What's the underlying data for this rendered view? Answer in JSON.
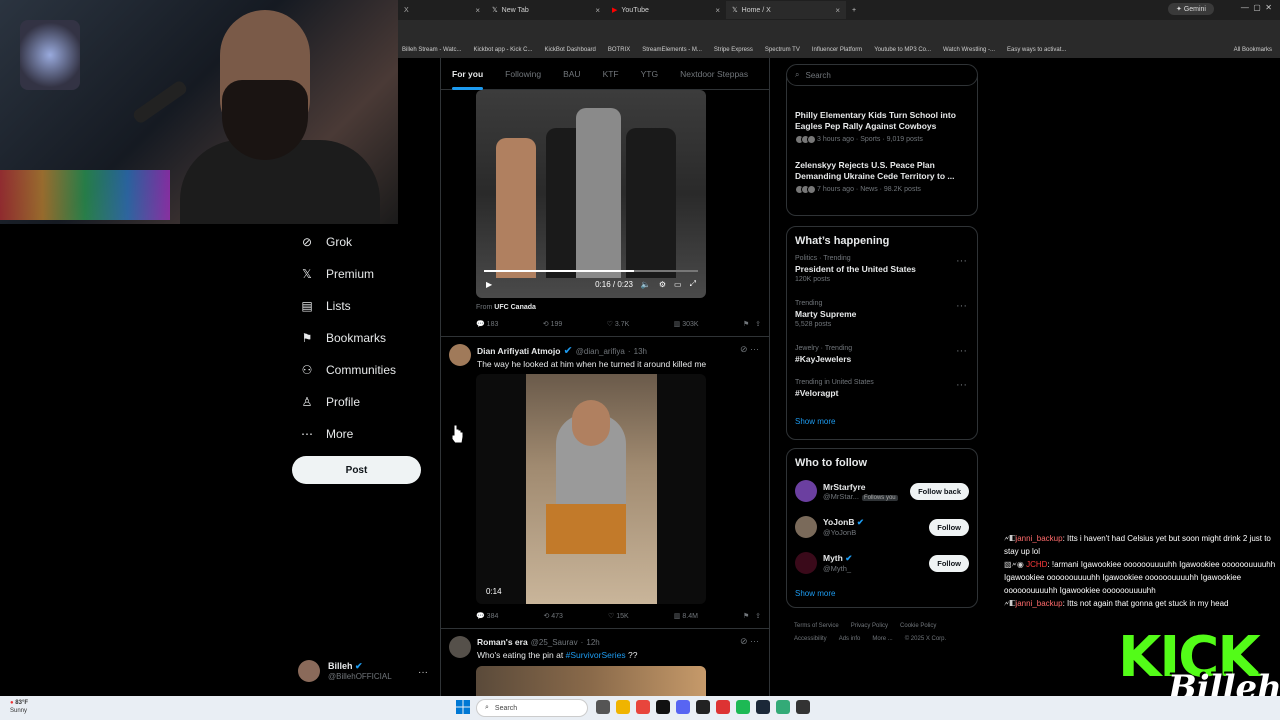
{
  "browser": {
    "tabs": [
      {
        "label": "New Tab",
        "icon": "x-logo-icon"
      },
      {
        "label": "YouTube",
        "icon": "youtube-icon"
      },
      {
        "label": "Home / X",
        "icon": "x-logo-icon"
      }
    ],
    "gemini_label": "Gemini",
    "bookmarks": [
      "Billeh Stream - Watc...",
      "Kickbot app - Kick C...",
      "KickBot Dashboard",
      "BOTRIX",
      "StreamElements - M...",
      "Stripe Express",
      "Spectrum TV",
      "Influencer Platform",
      "Youtube to MP3 Co...",
      "Watch Wrestling -...",
      "Easy ways to activat...",
      "All Bookmarks"
    ]
  },
  "sidebar": {
    "items": [
      {
        "label": "Grok",
        "icon": "grok-icon"
      },
      {
        "label": "Premium",
        "icon": "x-logo-icon"
      },
      {
        "label": "Lists",
        "icon": "list-icon"
      },
      {
        "label": "Bookmarks",
        "icon": "bookmark-icon"
      },
      {
        "label": "Communities",
        "icon": "communities-icon"
      },
      {
        "label": "Profile",
        "icon": "profile-icon"
      },
      {
        "label": "More",
        "icon": "more-circle-icon"
      }
    ],
    "post_label": "Post",
    "account": {
      "name": "Billeh",
      "handle": "@BillehOFFICIAL"
    }
  },
  "feed": {
    "tabs": [
      "For you",
      "Following",
      "BAU",
      "KTF",
      "YTG",
      "Nextdoor Steppas"
    ],
    "video1": {
      "time": "0:16 / 0:23",
      "from_prefix": "From",
      "from_name": "UFC Canada"
    },
    "actions1": {
      "replies": "183",
      "reposts": "199",
      "likes": "3.7K",
      "views": "303K"
    },
    "tweet2": {
      "name": "Dian Arifiyati Atmojo",
      "handle": "@dian_arifiya",
      "time": "13h",
      "text": "The way he looked at him when he turned it around killed me",
      "video_time": "0:14"
    },
    "actions2": {
      "replies": "384",
      "reposts": "473",
      "likes": "15K",
      "views": "8.4M"
    },
    "tweet3": {
      "name": "Roman's era",
      "handle": "@25_Saurav",
      "time": "12h",
      "text_prefix": "Who's eating the pin at",
      "hashtag": "#SurvivorSeries",
      "text_suffix": "??"
    }
  },
  "right": {
    "search_placeholder": "Search",
    "news": [
      {
        "title": "Philly Elementary Kids Turn School into Eagles Pep Rally Against Cowboys",
        "meta": "3 hours ago · Sports · 9,019 posts"
      },
      {
        "title": "Zelenskyy Rejects U.S. Peace Plan Demanding Ukraine Cede Territory to ...",
        "meta": "7 hours ago · News · 98.2K posts"
      }
    ],
    "happening_title": "What’s happening",
    "trends": [
      {
        "cat": "Politics · Trending",
        "name": "President of the United States",
        "count": "120K posts"
      },
      {
        "cat": "Trending",
        "name": "Marty Supreme",
        "count": "5,528 posts"
      },
      {
        "cat": "Jewelry · Trending",
        "name": "#KayJewelers",
        "count": ""
      },
      {
        "cat": "Trending in United States",
        "name": "#Veloragpt",
        "count": ""
      }
    ],
    "show_more": "Show more",
    "wtf_title": "Who to follow",
    "follow": [
      {
        "name": "MrStarfyre",
        "handle": "@MrStar...",
        "badge": "Follows you",
        "button": "Follow back",
        "color": "#6b3fa0"
      },
      {
        "name": "YoJonB",
        "handle": "@YoJonB",
        "badge": "",
        "button": "Follow",
        "color": "#7a6a5a"
      },
      {
        "name": "Myth",
        "handle": "@Myth_",
        "badge": "",
        "button": "Follow",
        "color": "#3a0a1a"
      }
    ],
    "legal": [
      "Terms of Service",
      "Privacy Policy",
      "Cookie Policy",
      "Accessibility",
      "Ads info",
      "More ...",
      "© 2025 X Corp."
    ]
  },
  "chat": [
    {
      "user": "janni_backup",
      "text": ": Itts i haven't had Celsius yet but soon might drink 2 just to stay up lol"
    },
    {
      "user": "JCHD",
      "text": ": !armani Igawookiee oooooouuuuhh Igawookiee oooooouuuuhh Igawookiee oooooouuuuhh Igawookiee oooooouuuuhh Igawookiee oooooouuuuhh Igawookiee oooooouuuuhh"
    },
    {
      "user": "janni_backup",
      "text": ": Itts not again that gonna get stuck in my head"
    }
  ],
  "overlay": {
    "kick": "KICK",
    "signature": "Billeh"
  },
  "taskbar": {
    "temp": "83°F",
    "condition": "Sunny",
    "search": "Search"
  },
  "colors": {
    "accent": "#1d9bf0",
    "kick_green": "#53fc18"
  }
}
